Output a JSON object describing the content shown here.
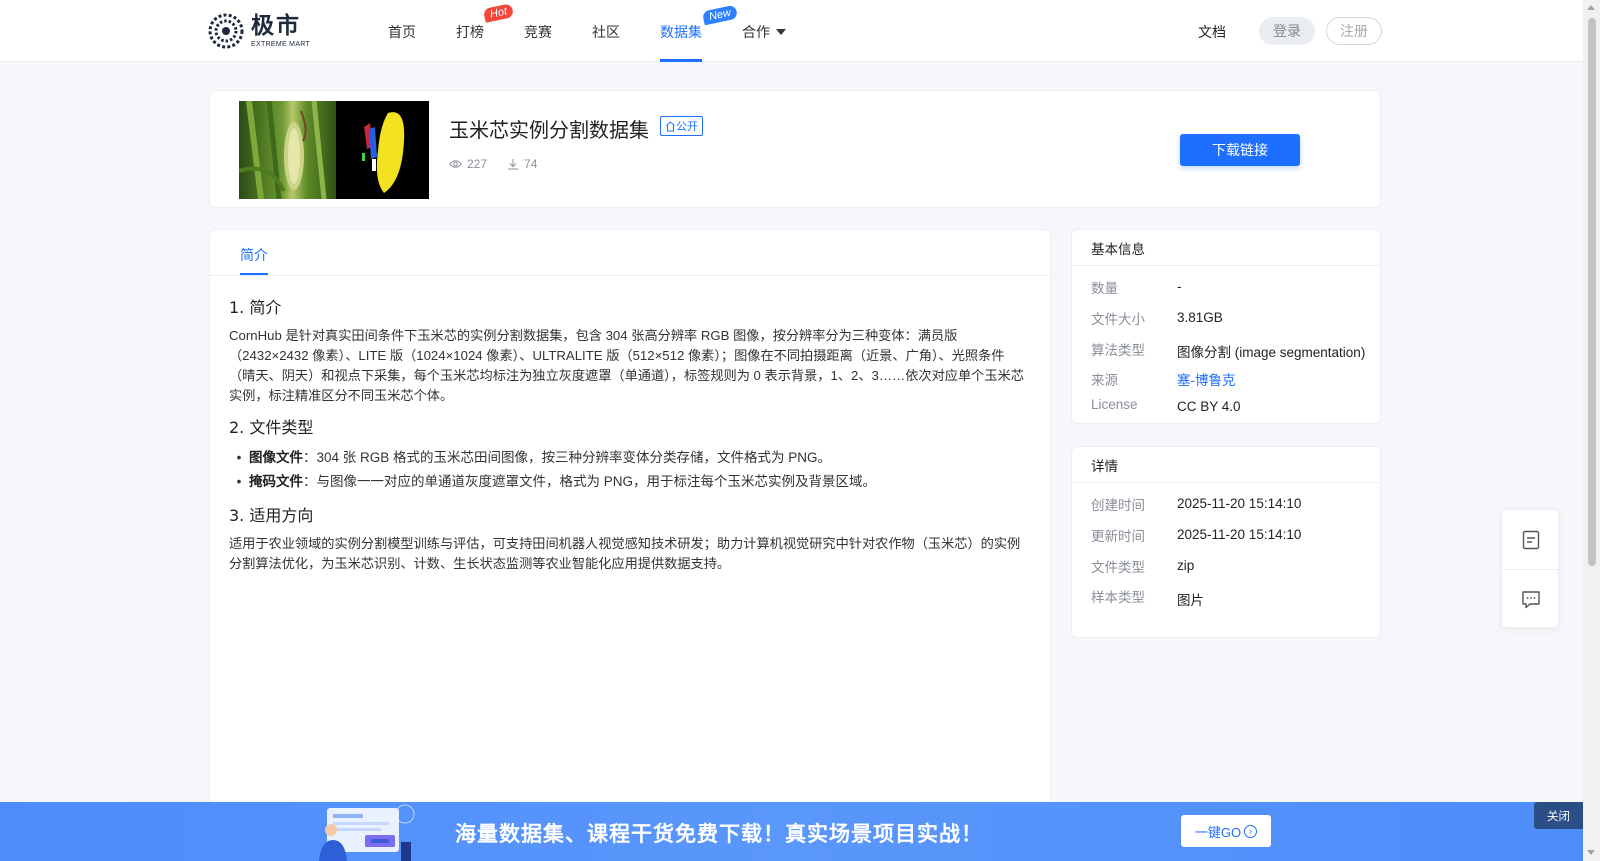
{
  "header": {
    "logo_cn": "极市",
    "logo_en": "EXTREME MART",
    "nav": [
      {
        "label": "首页"
      },
      {
        "label": "打榜",
        "badge": "Hot"
      },
      {
        "label": "竞赛"
      },
      {
        "label": "社区"
      },
      {
        "label": "数据集",
        "badge": "New",
        "active": true
      },
      {
        "label": "合作"
      }
    ],
    "docs_label": "文档",
    "login_label": "登录",
    "register_label": "注册"
  },
  "dataset": {
    "title": "玉米芯实例分割数据集",
    "visibility": "公开",
    "views": "227",
    "downloads": "74",
    "download_button": "下载链接"
  },
  "tabs": {
    "intro_label": "简介"
  },
  "content": {
    "s1_title": "1. 简介",
    "s1_text": "CornHub 是针对真实田间条件下玉米芯的实例分割数据集，包含 304 张高分辨率 RGB 图像，按分辨率分为三种变体：满员版（2432×2432 像素）、LITE 版（1024×1024 像素）、ULTRALITE 版（512×512 像素）；图像在不同拍摄距离（近景、广角）、光照条件（晴天、阴天）和视点下采集，每个玉米芯均标注为独立灰度遮罩（单通道），标签规则为 0 表示背景，1、2、3……依次对应单个玉米芯实例，标注精准区分不同玉米芯个体。",
    "s2_title": "2. 文件类型",
    "s2_items": [
      {
        "term": "图像文件",
        "desc": "：304 张 RGB 格式的玉米芯田间图像，按三种分辨率变体分类存储，文件格式为 PNG。"
      },
      {
        "term": "掩码文件",
        "desc": "：与图像一一对应的单通道灰度遮罩文件，格式为 PNG，用于标注每个玉米芯实例及背景区域。"
      }
    ],
    "s3_title": "3. 适用方向",
    "s3_text": "适用于农业领域的实例分割模型训练与评估，可支持田间机器人视觉感知技术研发；助力计算机视觉研究中针对农作物（玉米芯）的实例分割算法优化，为玉米芯识别、计数、生长状态监测等农业智能化应用提供数据支持。"
  },
  "basic_info": {
    "title": "基本信息",
    "rows": [
      {
        "key": "数量",
        "value": "-"
      },
      {
        "key": "文件大小",
        "value": "3.81GB"
      },
      {
        "key": "算法类型",
        "value": "图像分割 (image segmentation)"
      },
      {
        "key": "来源",
        "value": "塞-博鲁克"
      },
      {
        "key": "License",
        "value": "CC BY 4.0"
      }
    ]
  },
  "details": {
    "title": "详情",
    "rows": [
      {
        "key": "创建时间",
        "value": "2025-11-20 15:14:10"
      },
      {
        "key": "更新时间",
        "value": "2025-11-20 15:14:10"
      },
      {
        "key": "文件类型",
        "value": "zip"
      },
      {
        "key": "样本类型",
        "value": "图片"
      }
    ]
  },
  "banner": {
    "text": "海量数据集、课程干货免费下载！真实场景项目实战！",
    "go_label": "一键GO",
    "close_label": "关闭"
  },
  "colors": {
    "accent": "#1e6fff",
    "hot": "#f5473b",
    "banner": "#4c8dfb"
  }
}
